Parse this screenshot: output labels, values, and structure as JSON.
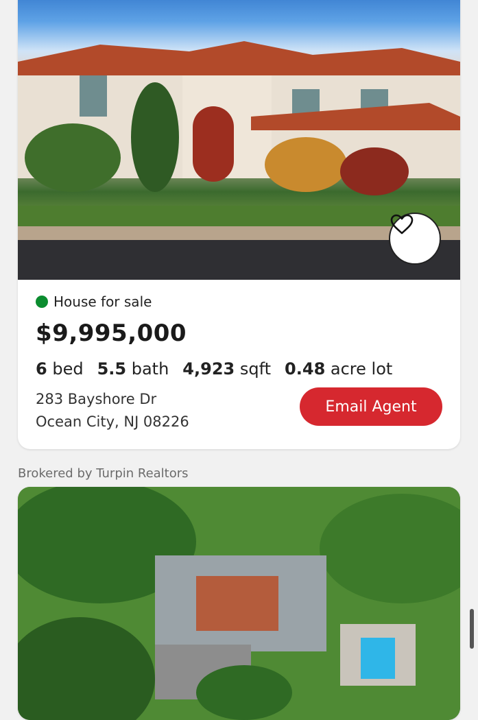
{
  "listing1": {
    "status": "House for sale",
    "price": "$9,995,000",
    "beds_value": "6",
    "beds_label": "bed",
    "baths_value": "5.5",
    "baths_label": "bath",
    "sqft_value": "4,923",
    "sqft_label": "sqft",
    "lot_value": "0.48",
    "lot_label": "acre lot",
    "address_line1": "283 Bayshore Dr",
    "address_line2": "Ocean City, NJ 08226",
    "email_button": "Email Agent",
    "favorite_icon": "heart-icon"
  },
  "broker": "Brokered by Turpin Realtors",
  "colors": {
    "accent": "#d6282f",
    "status_dot": "#0b8c2f"
  }
}
